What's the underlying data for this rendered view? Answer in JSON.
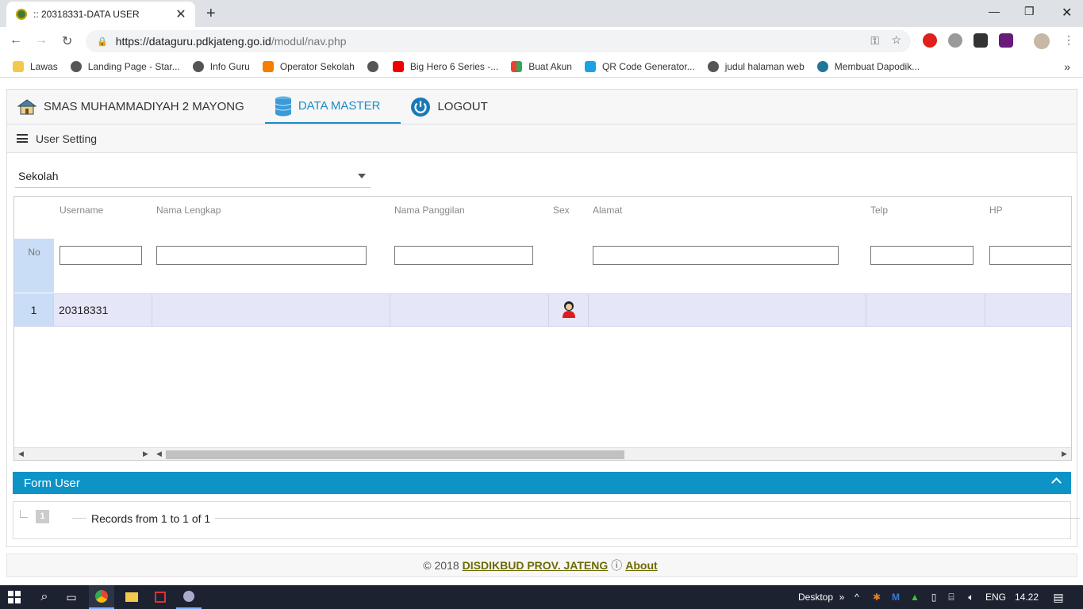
{
  "browser": {
    "tab_title": ":: 20318331-DATA USER",
    "url_host": "https://dataguru.pdkjateng.go.id",
    "url_path": "/modul/nav.php",
    "bookmarks": [
      "Lawas",
      "Landing Page - Star...",
      "Info Guru",
      "Operator Sekolah",
      "Big Hero 6 Series -...",
      "Buat Akun",
      "QR Code Generator...",
      "judul halaman web",
      "Membuat Dapodik..."
    ],
    "more": "»"
  },
  "app": {
    "nav": {
      "school": "SMAS MUHAMMADIYAH 2 MAYONG",
      "data_master": "DATA MASTER",
      "logout": "LOGOUT"
    },
    "subbar": {
      "title": "User Setting"
    },
    "select": {
      "value": "Sekolah"
    },
    "grid": {
      "headers": [
        "Username",
        "Nama Lengkap",
        "Nama Panggilan",
        "Sex",
        "Alamat",
        "Telp",
        "HP"
      ],
      "no_header": "No",
      "rows": [
        {
          "no": "1",
          "username": "20318331",
          "nama_lengkap": "",
          "nama_panggilan": "",
          "sex": "female-icon",
          "alamat": "",
          "telp": "",
          "hp": ""
        }
      ]
    },
    "form_user": {
      "title": "Form User"
    },
    "pager": {
      "page": "1",
      "records": "Records from 1 to 1 of 1"
    },
    "footer": {
      "copyright": "© 2018",
      "org": "DISDIKBUD PROV. JATENG",
      "info": "ⓘ",
      "about": "About"
    }
  },
  "taskbar": {
    "desktop": "Desktop",
    "lang": "ENG",
    "time": "14.22"
  },
  "colors": {
    "accent": "#0e93c7",
    "row_highlight": "#e6e6f9",
    "no_col": "#c9ddf6"
  }
}
